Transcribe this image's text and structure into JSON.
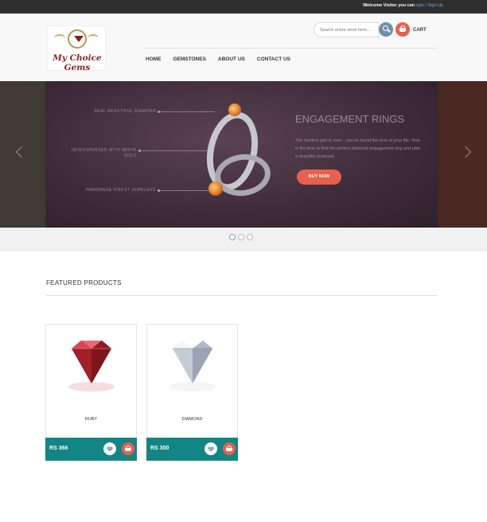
{
  "topbar": {
    "welcome": "Welcome Visitor you can",
    "login": "Login",
    "separator": " / ",
    "signup": "Sign Up"
  },
  "header": {
    "brand": "My Choice Gems",
    "search_placeholder": "Search entire store here...",
    "cart_label": "CART",
    "nav": [
      "HOME",
      "GEMSTONES",
      "ABOUT US",
      "CONTACT US"
    ]
  },
  "slider": {
    "callouts": [
      "REAL BEAUTIFUL DIAMOND",
      "INTERSPERSED WITH WHITE GOLD",
      "HANDMADE FINEST JEWELERS"
    ],
    "title": "ENGAGEMENT RINGS",
    "text": "The hardest part is over – you've found the love of your life. Now is the time to find the perfect diamond engagement ring and plan a beautiful proposal.",
    "button": "BUY NOW",
    "dot_count": 3,
    "active_dot": 1
  },
  "featured": {
    "title": "FEATURED PRODUCTS",
    "products": [
      {
        "name": "RUBY",
        "price": "RS 366",
        "color": "#b52530"
      },
      {
        "name": "DIAMOND",
        "price": "RS 300",
        "color": "#d7dde6"
      }
    ]
  },
  "colors": {
    "accent": "#e8604c",
    "teal": "#138584",
    "topbar": "#2f2f2f"
  }
}
